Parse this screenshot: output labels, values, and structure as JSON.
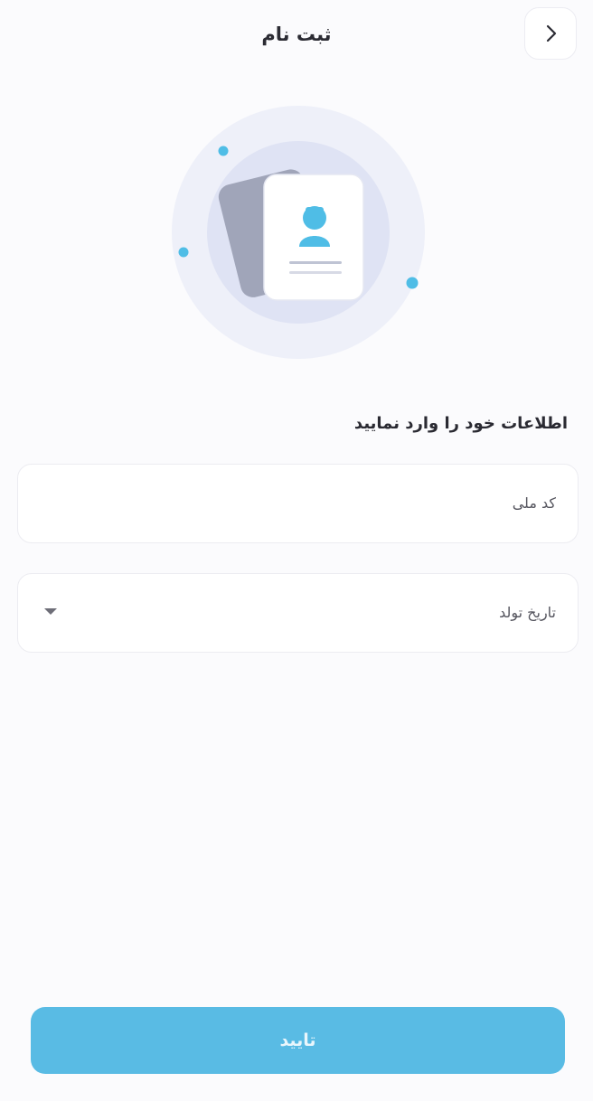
{
  "header": {
    "title": "ثبت نام",
    "back_icon": "chevron-right-icon"
  },
  "illustration": {
    "icon": "id-card-user-icon",
    "accent_color": "#4fbde6",
    "circle_color": "#dfe3f4"
  },
  "form": {
    "intro": "اطلاعات خود را وارد نمایید",
    "national_code_label": "کد ملی",
    "birth_date_label": "تاریخ تولد",
    "birth_date_icon": "caret-down-icon"
  },
  "actions": {
    "submit_label": "تایید",
    "submit_color": "#59bbe4"
  }
}
